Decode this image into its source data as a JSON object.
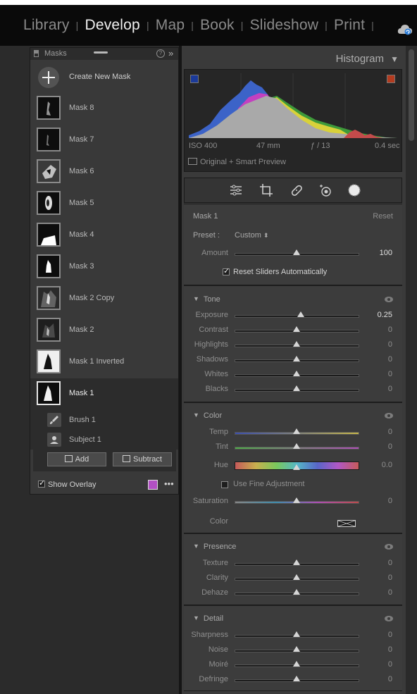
{
  "modules": [
    "Library",
    "Develop",
    "Map",
    "Book",
    "Slideshow",
    "Print"
  ],
  "active_module": "Develop",
  "masks_panel": {
    "title": "Masks",
    "create_label": "Create New Mask",
    "masks": [
      "Mask 8",
      "Mask 7",
      "Mask 6",
      "Mask 5",
      "Mask 4",
      "Mask 3",
      "Mask 2 Copy",
      "Mask 2",
      "Mask 1 Inverted",
      "Mask 1"
    ],
    "selected_mask": "Mask 1",
    "components": [
      "Brush 1",
      "Subject 1"
    ],
    "add_label": "Add",
    "subtract_label": "Subtract",
    "show_overlay_label": "Show Overlay",
    "show_overlay_checked": true,
    "overlay_color": "#b250c4"
  },
  "histogram": {
    "title": "Histogram",
    "iso": "ISO 400",
    "focal": "47 mm",
    "aperture": "ƒ / 13",
    "shutter": "0.4 sec",
    "preview": "Original + Smart Preview"
  },
  "mask_settings": {
    "name": "Mask 1",
    "reset_label": "Reset",
    "preset_label": "Preset :",
    "preset_value": "Custom",
    "amount_label": "Amount",
    "amount_value": "100",
    "reset_sliders_label": "Reset Sliders Automatically",
    "reset_sliders_checked": true
  },
  "tone": {
    "title": "Tone",
    "sliders": [
      {
        "label": "Exposure",
        "value": "0.25",
        "fraction": 0.535
      },
      {
        "label": "Contrast",
        "value": "0",
        "fraction": 0.5
      },
      {
        "label": "Highlights",
        "value": "0",
        "fraction": 0.5
      },
      {
        "label": "Shadows",
        "value": "0",
        "fraction": 0.5
      },
      {
        "label": "Whites",
        "value": "0",
        "fraction": 0.5
      },
      {
        "label": "Blacks",
        "value": "0",
        "fraction": 0.5
      }
    ]
  },
  "color": {
    "title": "Color",
    "temp_label": "Temp",
    "temp_value": "0",
    "tint_label": "Tint",
    "tint_value": "0",
    "hue_label": "Hue",
    "hue_value": "0.0",
    "fine_label": "Use Fine Adjustment",
    "saturation_label": "Saturation",
    "saturation_value": "0",
    "color_label": "Color"
  },
  "presence": {
    "title": "Presence",
    "sliders": [
      {
        "label": "Texture",
        "value": "0",
        "fraction": 0.5
      },
      {
        "label": "Clarity",
        "value": "0",
        "fraction": 0.5
      },
      {
        "label": "Dehaze",
        "value": "0",
        "fraction": 0.5
      }
    ]
  },
  "detail": {
    "title": "Detail",
    "sliders": [
      {
        "label": "Sharpness",
        "value": "0",
        "fraction": 0.5
      },
      {
        "label": "Noise",
        "value": "0",
        "fraction": 0.5
      },
      {
        "label": "Moiré",
        "value": "0",
        "fraction": 0.5
      },
      {
        "label": "Defringe",
        "value": "0",
        "fraction": 0.5
      }
    ]
  }
}
